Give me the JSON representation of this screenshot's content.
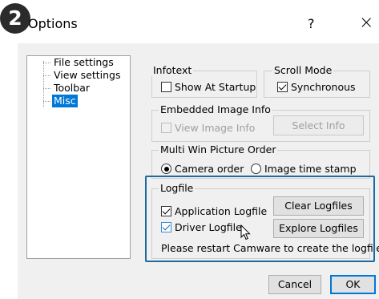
{
  "step_badge": "2",
  "window": {
    "title": "Options",
    "help_label": "?",
    "close_label": "×"
  },
  "tree": {
    "items": [
      {
        "label": "File settings",
        "selected": false
      },
      {
        "label": "View settings",
        "selected": false
      },
      {
        "label": "Toolbar",
        "selected": false
      },
      {
        "label": "Misc",
        "selected": true
      }
    ]
  },
  "infotext": {
    "title": "Infotext",
    "show_at_startup": {
      "label": "Show At Startup",
      "checked": false
    }
  },
  "scroll_mode": {
    "title": "Scroll Mode",
    "synchronous": {
      "label": "Synchronous",
      "checked": true
    }
  },
  "embedded_image_info": {
    "title": "Embedded Image Info",
    "view_image_info": {
      "label": "View Image Info",
      "checked": false,
      "disabled": true
    },
    "select_info_label": "Select Info"
  },
  "multi_win": {
    "title": "Multi Win Picture Order",
    "options": [
      {
        "label": "Camera order",
        "selected": true
      },
      {
        "label": "Image time stamp",
        "selected": false
      }
    ]
  },
  "logfile": {
    "title": "Logfile",
    "application_logfile": {
      "label": "Application Logfile",
      "checked": true
    },
    "driver_logfile": {
      "label": "Driver Logfile",
      "checked": true
    },
    "clear_label": "Clear Logfiles",
    "explore_label": "Explore Logfiles",
    "note": "Please restart Camware to create the logfiles!"
  },
  "footer": {
    "cancel_label": "Cancel",
    "ok_label": "OK"
  },
  "colors": {
    "highlight_border": "#1c6b9e",
    "selection": "#0078d7"
  }
}
